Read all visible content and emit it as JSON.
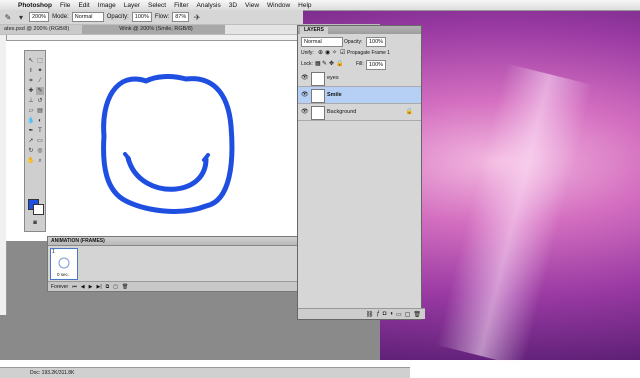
{
  "menubar": {
    "app": "Photoshop",
    "items": [
      "File",
      "Edit",
      "Image",
      "Layer",
      "Select",
      "Filter",
      "Analysis",
      "3D",
      "View",
      "Window",
      "Help"
    ]
  },
  "options": {
    "mode_label": "Mode:",
    "mode_value": "Normal",
    "opacity_label": "Opacity:",
    "opacity_value": "100%",
    "flow_label": "Flow:",
    "flow_value": "87%",
    "zoom_value": "200%"
  },
  "tabs": [
    {
      "label": "ates.psd @ 200% (RGB/8)"
    },
    {
      "label": "Wink @ 200% (Smile, RGB/8)"
    },
    {
      "label": ""
    }
  ],
  "animation": {
    "title": "ANIMATION (FRAMES)",
    "frame_number": "1",
    "frame_delay": "0 sec.",
    "loop": "Forever"
  },
  "status": {
    "doc": "Doc: 193.2K/311.8K"
  },
  "layers": {
    "tab": "LAYERS",
    "blend_mode": "Normal",
    "opacity_label": "Opacity:",
    "opacity_value": "100%",
    "unify_label": "Unify:",
    "propagate_label": "Propagate Frame 1",
    "lock_label": "Lock:",
    "fill_label": "Fill:",
    "fill_value": "100%",
    "items": [
      {
        "name": "eyes"
      },
      {
        "name": "Smile",
        "selected": true
      },
      {
        "name": "Background"
      }
    ]
  },
  "colors": {
    "foreground": "#1f4fe0",
    "background": "#ffffff",
    "selected_layer": "#b6d0f5"
  }
}
